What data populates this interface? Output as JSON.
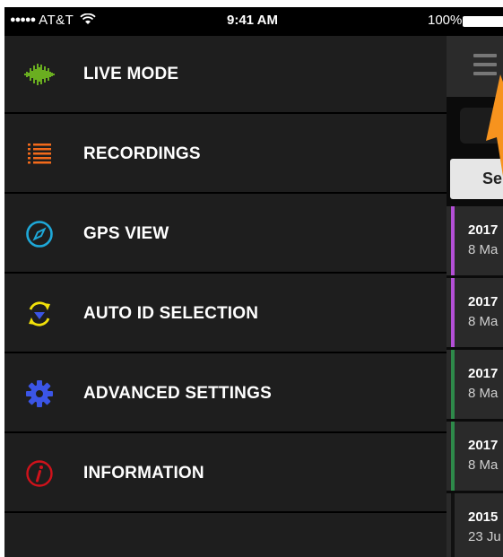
{
  "status_bar": {
    "signal": "●●●●●",
    "carrier": "AT&T",
    "wifi_icon": "wifi-icon",
    "time": "9:41 AM",
    "battery_pct": "100%"
  },
  "menu": {
    "items": [
      {
        "label": "LIVE MODE",
        "icon": "waveform-icon",
        "color": "#7ed321"
      },
      {
        "label": "RECORDINGS",
        "icon": "list-icon",
        "color": "#f26a1b"
      },
      {
        "label": "GPS VIEW",
        "icon": "compass-icon",
        "color": "#1ea8d8"
      },
      {
        "label": "AUTO ID SELECTION",
        "icon": "auto-id-icon",
        "color": "#f2e10a"
      },
      {
        "label": "ADVANCED SETTINGS",
        "icon": "gear-icon",
        "color": "#3b55e6"
      },
      {
        "label": "INFORMATION",
        "icon": "info-icon",
        "color": "#d0121b"
      }
    ]
  },
  "right_panel": {
    "search_label": "Se",
    "recordings": [
      {
        "line1": "2017",
        "line2": "8 Ma",
        "color": "#b44fd6"
      },
      {
        "line1": "2017",
        "line2": "8 Ma",
        "color": "#b44fd6"
      },
      {
        "line1": "2017",
        "line2": "8 Ma",
        "color": "#2e8a4a"
      },
      {
        "line1": "2017",
        "line2": "8 Ma",
        "color": "#2e8a4a"
      },
      {
        "line1": "2015",
        "line2": "23 Ju",
        "color": "#111111"
      }
    ]
  }
}
